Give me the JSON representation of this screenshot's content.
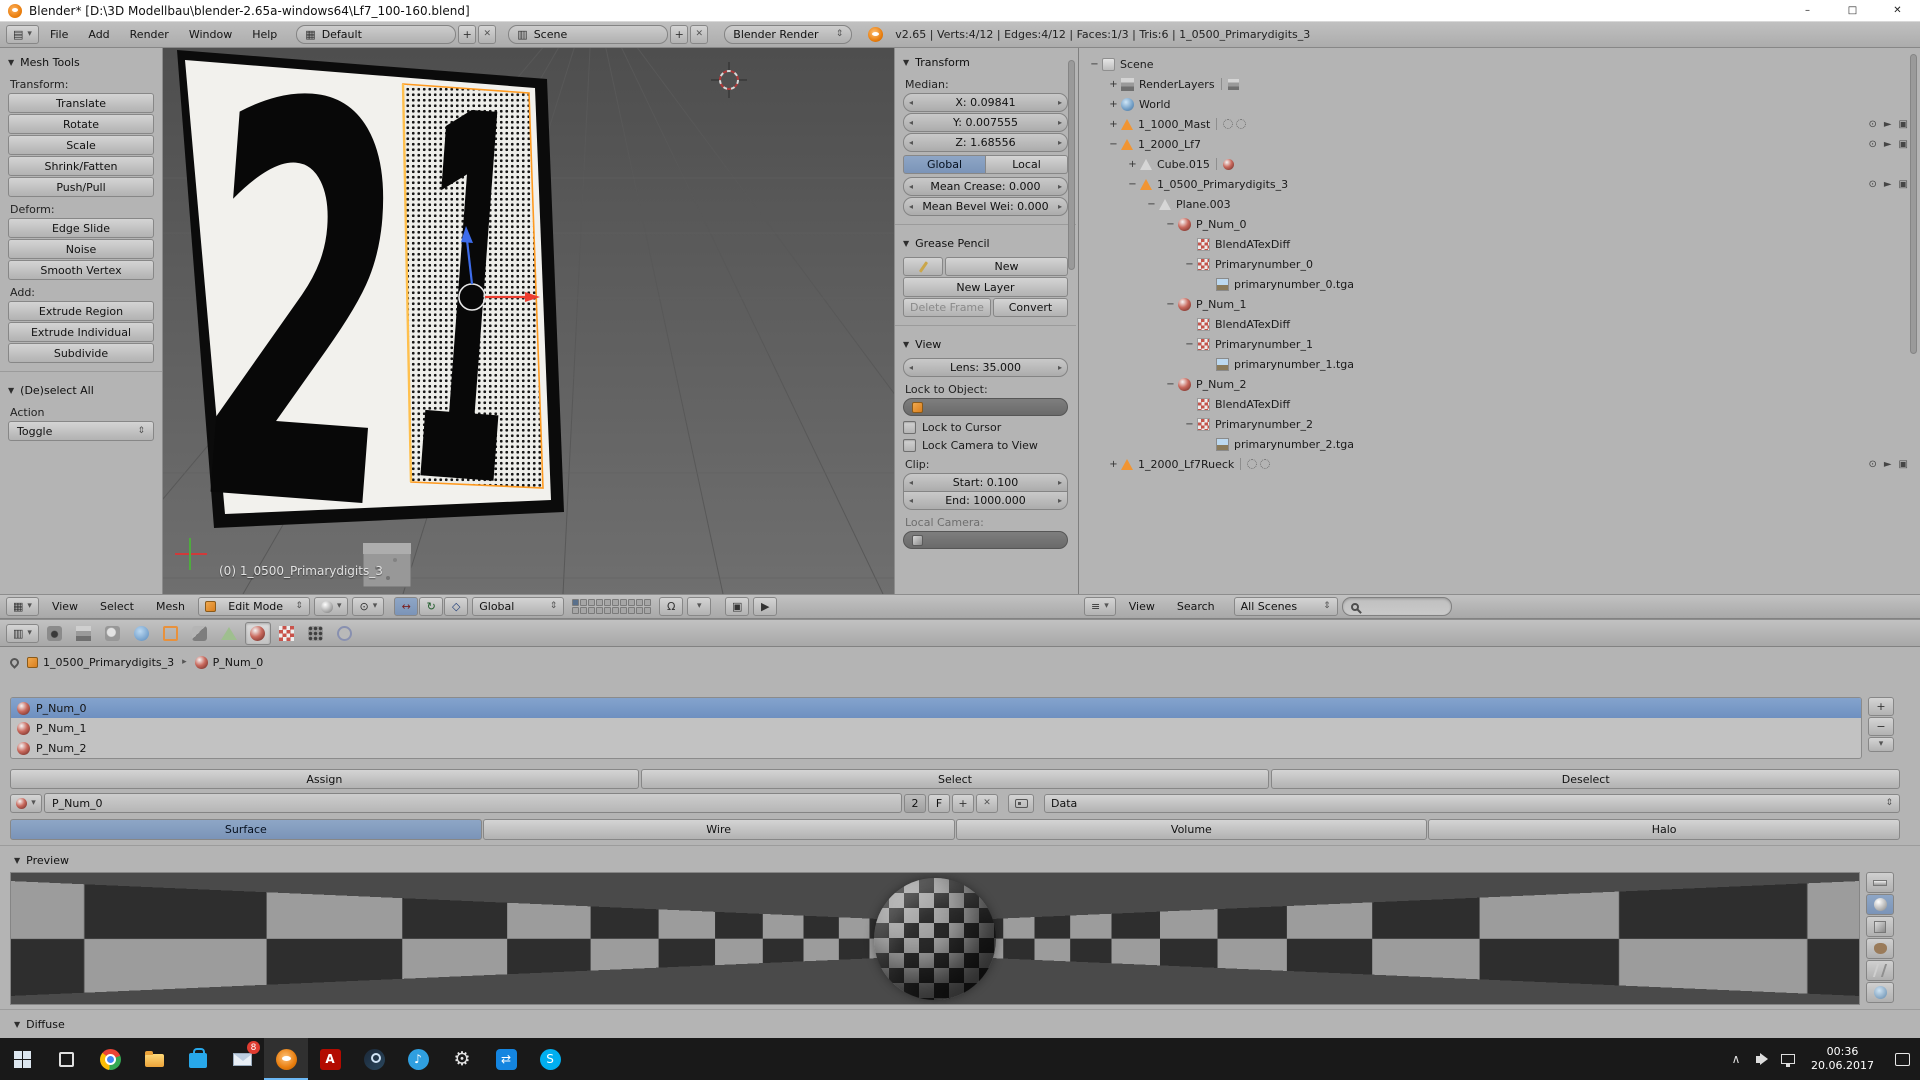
{
  "window": {
    "title": "Blender* [D:\\3D Modellbau\\blender-2.65a-windows64\\Lf7_100-160.blend]"
  },
  "icons": {
    "panel_arrow": "▼",
    "collapse": "−",
    "expand": "+",
    "minus": "−",
    "plus": "+",
    "cross": "✕",
    "minimize": "–",
    "maximize": "□",
    "dropdown": "▾",
    "updown": "⇕",
    "spin_left": "◂",
    "spin_right": "▸",
    "breadcrumb_arrow": "▸",
    "editor_info": "▤",
    "editor_3d": "▦",
    "editor_outliner": "≡",
    "editor_props": "▥",
    "pivot": "⊙",
    "translate": "↔",
    "rotate": "↻",
    "scale": "◇",
    "magnet": "Ω",
    "camera": "▣",
    "play": "▶",
    "eye": "⊙",
    "pointer": "►",
    "gear": "⚙",
    "music": "♪",
    "swap": "⇄",
    "chevron_up": "∧",
    "letter_a": "A",
    "letter_s": "S"
  },
  "info_bar": {
    "menus": [
      "File",
      "Add",
      "Render",
      "Window",
      "Help"
    ],
    "layout_value": "Default",
    "scene_value": "Scene",
    "engine_value": "Blender Render",
    "stats": "v2.65 | Verts:4/12 | Edges:4/12 | Faces:1/3 | Tris:6 | 1_0500_Primarydigits_3"
  },
  "tool_shelf": {
    "mesh_tools_title": "Mesh Tools",
    "transform_label": "Transform:",
    "transform_buttons": [
      "Translate",
      "Rotate",
      "Scale",
      "Shrink/Fatten",
      "Push/Pull"
    ],
    "deform_label": "Deform:",
    "deform_buttons": [
      "Edge Slide",
      "Noise",
      "Smooth Vertex"
    ],
    "add_label": "Add:",
    "add_buttons": [
      "Extrude Region",
      "Extrude Individual",
      "Subdivide"
    ],
    "deselect_title": "(De)select All",
    "action_label": "Action",
    "action_value": "Toggle"
  },
  "viewport": {
    "digit_left": "2",
    "digit_right": "1",
    "object_info": "(0) 1_0500_Primarydigits_3",
    "header": {
      "menus": [
        "View",
        "Select",
        "Mesh"
      ],
      "mode": "Edit Mode",
      "orientation": "Global"
    }
  },
  "n_panel": {
    "transform_title": "Transform",
    "median_label": "Median:",
    "median_x": "X: 0.09841",
    "median_y": "Y: 0.007555",
    "median_z": "Z: 1.68556",
    "global_label": "Global",
    "local_label": "Local",
    "mean_crease": "Mean Crease: 0.000",
    "mean_bevel": "Mean Bevel Wei: 0.000",
    "grease_title": "Grease Pencil",
    "new_label": "New",
    "new_layer_label": "New Layer",
    "delete_frame_label": "Delete Frame",
    "convert_label": "Convert",
    "view_title": "View",
    "lens_value": "Lens: 35.000",
    "lock_object_label": "Lock to Object:",
    "lock_cursor_label": "Lock to Cursor",
    "lock_camera_label": "Lock Camera to View",
    "clip_label": "Clip:",
    "clip_start": "Start: 0.100",
    "clip_end": "End: 1000.000",
    "local_camera_label": "Local Camera:"
  },
  "outliner": {
    "header_menus": [
      "View",
      "Search"
    ],
    "scenes_filter": "All Scenes",
    "tree": [
      {
        "label": "Scene"
      },
      {
        "label": "RenderLayers"
      },
      {
        "label": "World"
      },
      {
        "label": "1_1000_Mast"
      },
      {
        "label": "1_2000_Lf7"
      },
      {
        "label": "Cube.015"
      },
      {
        "label": "1_0500_Primarydigits_3"
      },
      {
        "label": "Plane.003"
      },
      {
        "label": "P_Num_0"
      },
      {
        "label": "BlendATexDiff"
      },
      {
        "label": "Primarynumber_0"
      },
      {
        "label": "primarynumber_0.tga"
      },
      {
        "label": "P_Num_1"
      },
      {
        "label": "BlendATexDiff"
      },
      {
        "label": "Primarynumber_1"
      },
      {
        "label": "primarynumber_1.tga"
      },
      {
        "label": "P_Num_2"
      },
      {
        "label": "BlendATexDiff"
      },
      {
        "label": "Primarynumber_2"
      },
      {
        "label": "primarynumber_2.tga"
      },
      {
        "label": "1_2000_Lf7Rueck"
      }
    ]
  },
  "properties": {
    "breadcrumb": {
      "object": "1_0500_Primarydigits_3",
      "material": "P_Num_0"
    },
    "slots": [
      "P_Num_0",
      "P_Num_1",
      "P_Num_2"
    ],
    "assign_label": "Assign",
    "select_label": "Select",
    "deselect_label": "Deselect",
    "material_name": "P_Num_0",
    "users_count": "2",
    "fake_user_label": "F",
    "link_label": "Data",
    "tabs": [
      "Surface",
      "Wire",
      "Volume",
      "Halo"
    ],
    "preview_title": "Preview",
    "diffuse_title": "Diffuse"
  },
  "taskbar": {
    "time": "00:36",
    "date": "20.06.2017",
    "mail_badge": "8"
  }
}
